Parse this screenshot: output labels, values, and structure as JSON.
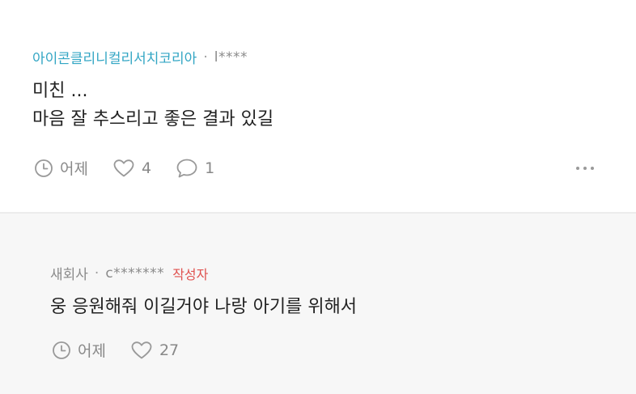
{
  "comments": [
    {
      "author": "아이콘클리니컬리서치코리아",
      "separator": "·",
      "masked_id": "l****",
      "lines": [
        "미친 ...",
        "마음 잘 추스리고 좋은 결과 있길"
      ],
      "time": "어제",
      "likes": "4",
      "replies": "1"
    },
    {
      "author": "새회사",
      "separator": "·",
      "masked_id": "c*******",
      "badge": "작성자",
      "lines": [
        "웅 응원해줘 이길거야 나랑 아기를 위해서"
      ],
      "time": "어제",
      "likes": "27"
    }
  ],
  "icons": {
    "clock": "clock-icon",
    "heart": "heart-icon",
    "reply": "speech-bubble-icon",
    "more": "more-dots-icon"
  },
  "colors": {
    "author_blue": "#33a6c4",
    "badge_red": "#e0524f",
    "reply_background": "#f7f7f7"
  }
}
